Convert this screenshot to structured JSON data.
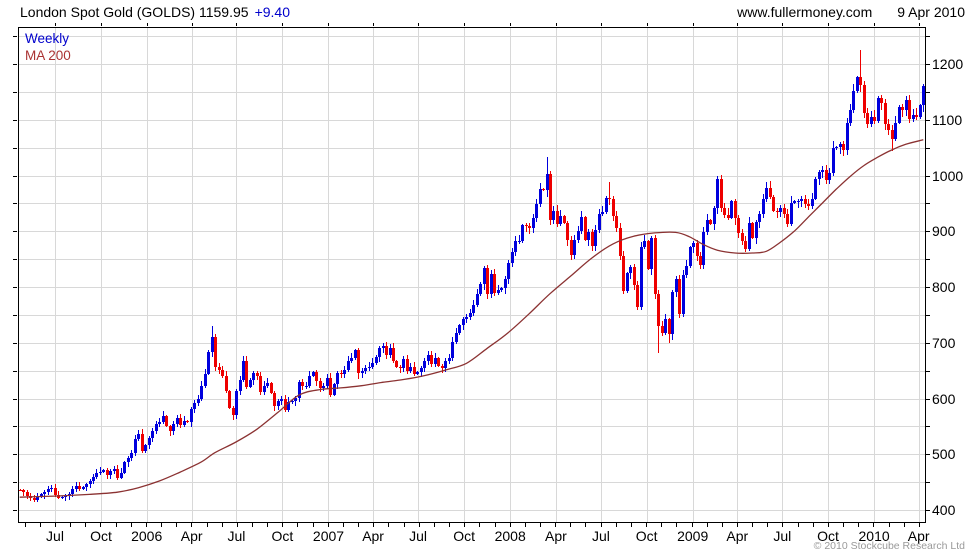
{
  "header": {
    "title": "London Spot Gold (GOLDS) 1159.95",
    "change": "+9.40",
    "change_color": "#0000cc",
    "site": "www.fullermoney.com",
    "date": "9 Apr 2010"
  },
  "legend": {
    "items": [
      {
        "label": "Weekly",
        "color": "#0000cc"
      },
      {
        "label": "MA 200",
        "color": "#aa3333"
      }
    ]
  },
  "footer": {
    "copyright": "© 2010 Stockcube Research Ltd",
    "color": "#9a9a9a"
  },
  "chart_data": {
    "type": "candlestick",
    "title": "London Spot Gold (GOLDS)",
    "periodicity": "Weekly",
    "last_price": 1159.95,
    "change": 9.4,
    "y_axis_side": "right",
    "ylim": [
      378,
      1266
    ],
    "y_ticks": [
      400,
      500,
      600,
      700,
      800,
      900,
      1000,
      1100,
      1200
    ],
    "y_minor_step": 50,
    "grid": true,
    "x_ticks": [
      {
        "label": "Jul",
        "week": 10.1
      },
      {
        "label": "Oct",
        "week": 23.3
      },
      {
        "label": "2006",
        "week": 36.4
      },
      {
        "label": "Apr",
        "week": 49.3
      },
      {
        "label": "Jul",
        "week": 62.1
      },
      {
        "label": "Oct",
        "week": 75.3
      },
      {
        "label": "2007",
        "week": 88.5
      },
      {
        "label": "Apr",
        "week": 101.3
      },
      {
        "label": "Jul",
        "week": 114.2
      },
      {
        "label": "Oct",
        "week": 127.4
      },
      {
        "label": "2008",
        "week": 140.6
      },
      {
        "label": "Apr",
        "week": 153.7
      },
      {
        "label": "Jul",
        "week": 166.6
      },
      {
        "label": "Oct",
        "week": 179.7
      },
      {
        "label": "2009",
        "week": 192.9
      },
      {
        "label": "Apr",
        "week": 205.7
      },
      {
        "label": "Jul",
        "week": 218.6
      },
      {
        "label": "Oct",
        "week": 231.7
      },
      {
        "label": "2010",
        "week": 244.9
      },
      {
        "label": "Apr",
        "week": 257.7
      }
    ],
    "x_minor_tick_start_week": 1.4,
    "x_minor_tick_step_weeks": 4.345,
    "first_open": 436,
    "weekly_closes": [
      435,
      432,
      426,
      421,
      418,
      423,
      428,
      433,
      438,
      440,
      427,
      422,
      424,
      425,
      429,
      437,
      443,
      437,
      441,
      446,
      452,
      459,
      466,
      469,
      472,
      463,
      470,
      474,
      458,
      467,
      486,
      494,
      503,
      528,
      537,
      505,
      517,
      530,
      542,
      554,
      558,
      569,
      550,
      542,
      555,
      565,
      552,
      560,
      558,
      582,
      592,
      600,
      623,
      644,
      684,
      711,
      657,
      651,
      641,
      613,
      583,
      571,
      613,
      634,
      668,
      621,
      634,
      645,
      641,
      612,
      623,
      627,
      610,
      586,
      595,
      599,
      580,
      593,
      596,
      601,
      629,
      622,
      622,
      640,
      648,
      632,
      619,
      622,
      637,
      607,
      626,
      646,
      644,
      652,
      668,
      672,
      687,
      645,
      650,
      654,
      657,
      663,
      675,
      690,
      694,
      678,
      690,
      667,
      657,
      655,
      671,
      650,
      656,
      644,
      648,
      655,
      667,
      678,
      661,
      672,
      658,
      655,
      668,
      673,
      702,
      717,
      732,
      743,
      747,
      754,
      768,
      787,
      806,
      834,
      787,
      824,
      789,
      794,
      798,
      815,
      843,
      862,
      882,
      882,
      911,
      909,
      905,
      923,
      948,
      975,
      974,
      1002,
      920,
      937,
      913,
      927,
      915,
      885,
      858,
      885,
      900,
      925,
      885,
      899,
      873,
      903,
      931,
      934,
      960,
      958,
      928,
      906,
      855,
      792,
      825,
      835,
      803,
      765,
      872,
      882,
      833,
      887,
      787,
      730,
      718,
      742,
      715,
      791,
      815,
      752,
      821,
      837,
      871,
      879,
      855,
      839,
      898,
      920,
      913,
      941,
      993,
      942,
      930,
      924,
      954,
      923,
      897,
      883,
      868,
      914,
      888,
      916,
      931,
      958,
      978,
      962,
      937,
      935,
      941,
      931,
      913,
      951,
      954,
      954,
      957,
      949,
      945,
      958,
      994,
      1006,
      1010,
      992,
      1004,
      1049,
      1051,
      1056,
      1045,
      1095,
      1117,
      1151,
      1176,
      1162,
      1113,
      1093,
      1105,
      1097,
      1139,
      1130,
      1092,
      1081,
      1066,
      1095,
      1123,
      1118,
      1135,
      1102,
      1108,
      1105,
      1126,
      1159.95
    ],
    "wick_overrides": {
      "55": {
        "high": 730
      },
      "151": {
        "high": 1033
      },
      "169": {
        "high": 988
      },
      "183": {
        "low": 681
      },
      "186": {
        "low": 699
      },
      "241": {
        "high": 1226
      },
      "250": {
        "low": 1044
      }
    },
    "ma200_points": [
      [
        0,
        423
      ],
      [
        10,
        425
      ],
      [
        20,
        428
      ],
      [
        28,
        432
      ],
      [
        34,
        440
      ],
      [
        40,
        452
      ],
      [
        46,
        468
      ],
      [
        52,
        486
      ],
      [
        56,
        503
      ],
      [
        62,
        522
      ],
      [
        68,
        545
      ],
      [
        74,
        575
      ],
      [
        80,
        606
      ],
      [
        86,
        616
      ],
      [
        92,
        619
      ],
      [
        98,
        623
      ],
      [
        104,
        629
      ],
      [
        110,
        634
      ],
      [
        116,
        641
      ],
      [
        122,
        651
      ],
      [
        128,
        663
      ],
      [
        134,
        690
      ],
      [
        140,
        718
      ],
      [
        146,
        752
      ],
      [
        152,
        788
      ],
      [
        158,
        820
      ],
      [
        164,
        852
      ],
      [
        170,
        877
      ],
      [
        176,
        891
      ],
      [
        182,
        897
      ],
      [
        188,
        898
      ],
      [
        192,
        890
      ],
      [
        196,
        876
      ],
      [
        200,
        866
      ],
      [
        205,
        861
      ],
      [
        210,
        861
      ],
      [
        214,
        864
      ],
      [
        218,
        880
      ],
      [
        222,
        900
      ],
      [
        226,
        925
      ],
      [
        230,
        950
      ],
      [
        234,
        975
      ],
      [
        238,
        998
      ],
      [
        242,
        1018
      ],
      [
        246,
        1033
      ],
      [
        250,
        1046
      ],
      [
        254,
        1056
      ],
      [
        259,
        1064
      ]
    ],
    "colors": {
      "up": "#0000dd",
      "down": "#ee0000",
      "ma": "#8b3232",
      "grid": "#d8d8d8",
      "axis": "#000000"
    }
  }
}
